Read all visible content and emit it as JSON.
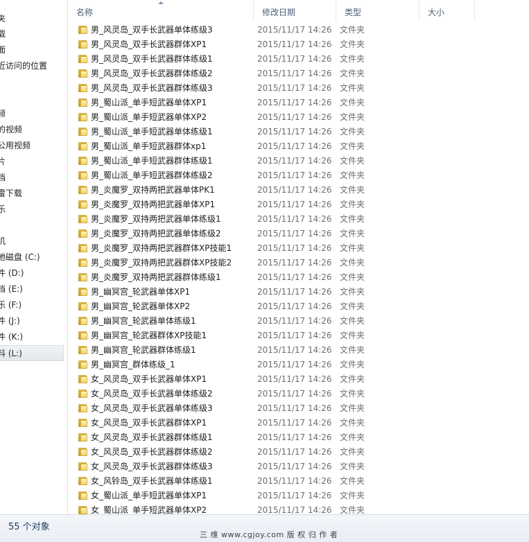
{
  "nav": {
    "items": [
      "夹",
      "载",
      "面",
      "近访问的位置",
      "",
      "",
      "频",
      "的视频",
      "公用视频",
      "片",
      "档",
      "雷下载",
      "乐",
      "",
      "机",
      "地磁盘 (C:)",
      "件 (D:)",
      "档 (E:)",
      "乐 (F:)",
      "件 (J:)",
      "件 (K:)",
      "料 (L:)"
    ],
    "selected_index": 21
  },
  "header": {
    "columns": [
      "名称",
      "修改日期",
      "类型",
      "大小"
    ]
  },
  "files": [
    {
      "name": "男_风灵岛_双手长武器单体练级3",
      "date": "2015/11/17 14:26",
      "type": "文件夹"
    },
    {
      "name": "男_风灵岛_双手长武器群体XP1",
      "date": "2015/11/17 14:26",
      "type": "文件夹"
    },
    {
      "name": "男_风灵岛_双手长武器群体练级1",
      "date": "2015/11/17 14:26",
      "type": "文件夹"
    },
    {
      "name": "男_风灵岛_双手长武器群体练级2",
      "date": "2015/11/17 14:26",
      "type": "文件夹"
    },
    {
      "name": "男_风灵岛_双手长武器群体练级3",
      "date": "2015/11/17 14:26",
      "type": "文件夹"
    },
    {
      "name": "男_蜀山派_单手短武器单体XP1",
      "date": "2015/11/17 14:26",
      "type": "文件夹"
    },
    {
      "name": "男_蜀山派_单手短武器单体XP2",
      "date": "2015/11/17 14:26",
      "type": "文件夹"
    },
    {
      "name": "男_蜀山派_单手短武器单体练级1",
      "date": "2015/11/17 14:26",
      "type": "文件夹"
    },
    {
      "name": "男_蜀山派_单手短武器群体xp1",
      "date": "2015/11/17 14:26",
      "type": "文件夹"
    },
    {
      "name": "男_蜀山派_单手短武器群体练级1",
      "date": "2015/11/17 14:26",
      "type": "文件夹"
    },
    {
      "name": "男_蜀山派_单手短武器群体练级2",
      "date": "2015/11/17 14:26",
      "type": "文件夹"
    },
    {
      "name": "男_炎魔罗_双持两把武器单体PK1",
      "date": "2015/11/17 14:26",
      "type": "文件夹"
    },
    {
      "name": "男_炎魔罗_双持两把武器单体XP1",
      "date": "2015/11/17 14:26",
      "type": "文件夹"
    },
    {
      "name": "男_炎魔罗_双持两把武器单体练级1",
      "date": "2015/11/17 14:26",
      "type": "文件夹"
    },
    {
      "name": "男_炎魔罗_双持两把武器单体练级2",
      "date": "2015/11/17 14:26",
      "type": "文件夹"
    },
    {
      "name": "男_炎魔罗_双持两把武器群体XP技能1",
      "date": "2015/11/17 14:26",
      "type": "文件夹"
    },
    {
      "name": "男_炎魔罗_双持两把武器群体XP技能2",
      "date": "2015/11/17 14:26",
      "type": "文件夹"
    },
    {
      "name": "男_炎魔罗_双持两把武器群体练级1",
      "date": "2015/11/17 14:26",
      "type": "文件夹"
    },
    {
      "name": "男_幽冥宫_轮武器单体XP1",
      "date": "2015/11/17 14:26",
      "type": "文件夹"
    },
    {
      "name": "男_幽冥宫_轮武器单体XP2",
      "date": "2015/11/17 14:26",
      "type": "文件夹"
    },
    {
      "name": "男_幽冥宫_轮武器单体练级1",
      "date": "2015/11/17 14:26",
      "type": "文件夹"
    },
    {
      "name": "男_幽冥宫_轮武器群体XP技能1",
      "date": "2015/11/17 14:26",
      "type": "文件夹"
    },
    {
      "name": "男_幽冥宫_轮武器群体练级1",
      "date": "2015/11/17 14:26",
      "type": "文件夹"
    },
    {
      "name": "男_幽冥宫_群体练级_1",
      "date": "2015/11/17 14:26",
      "type": "文件夹"
    },
    {
      "name": "女_风灵岛_双手长武器单体XP1",
      "date": "2015/11/17 14:26",
      "type": "文件夹"
    },
    {
      "name": "女_风灵岛_双手长武器单体练级2",
      "date": "2015/11/17 14:26",
      "type": "文件夹"
    },
    {
      "name": "女_风灵岛_双手长武器单体练级3",
      "date": "2015/11/17 14:26",
      "type": "文件夹"
    },
    {
      "name": "女_风灵岛_双手长武器群体XP1",
      "date": "2015/11/17 14:26",
      "type": "文件夹"
    },
    {
      "name": "女_风灵岛_双手长武器群体练级1",
      "date": "2015/11/17 14:26",
      "type": "文件夹"
    },
    {
      "name": "女_风灵岛_双手长武器群体练级2",
      "date": "2015/11/17 14:26",
      "type": "文件夹"
    },
    {
      "name": "女_风灵岛_双手长武器群体练级3",
      "date": "2015/11/17 14:26",
      "type": "文件夹"
    },
    {
      "name": "女_风铃岛_双手长武器单体练级1",
      "date": "2015/11/17 14:26",
      "type": "文件夹"
    },
    {
      "name": "女_蜀山派_单手短武器单体XP1",
      "date": "2015/11/17 14:26",
      "type": "文件夹"
    },
    {
      "name": "女_蜀山派_单手短武器单体XP2",
      "date": "2015/11/17 14:26",
      "type": "文件夹"
    }
  ],
  "status": {
    "count": "55 个对象",
    "watermark": "三 维 www.cgjoy.com 版 权 归 作 者"
  },
  "colors": {
    "header_text": "#4c607a",
    "secondary_text": "#6d6d6d",
    "folder": "#f2d36b"
  }
}
